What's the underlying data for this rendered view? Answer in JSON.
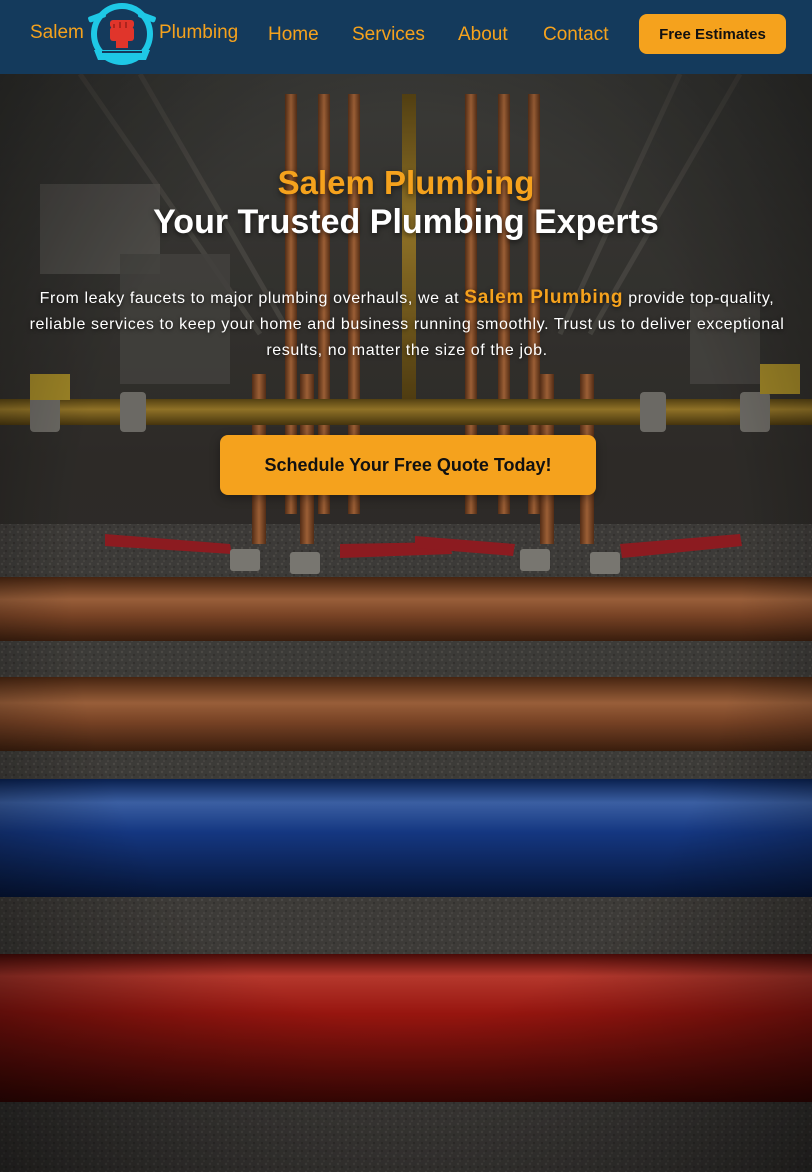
{
  "header": {
    "brand_left": "Salem",
    "brand_right": "Plumbing",
    "logo_icon": "fist-wrench-logo-icon",
    "nav": {
      "home": "Home",
      "services": "Services",
      "about": "About",
      "contact": "Contact"
    },
    "cta_label": "Free Estimates"
  },
  "hero": {
    "title": "Salem Plumbing",
    "subtitle": "Your Trusted Plumbing Experts",
    "body_before": "From leaky faucets to major plumbing overhauls, we at ",
    "body_brand": "Salem Plumbing",
    "body_after": " provide top-quality, reliable services to keep your home and business running smoothly. Trust us to deliver exceptional results, no matter the size of the job.",
    "cta_label": "Schedule Your Free Quote Today!",
    "background": "plumbing-pipes-photo"
  },
  "colors": {
    "nav_bg": "#143a5c",
    "accent": "#f5a21d",
    "logo_cyan": "#1ec8e6",
    "logo_red": "#e0352b"
  }
}
